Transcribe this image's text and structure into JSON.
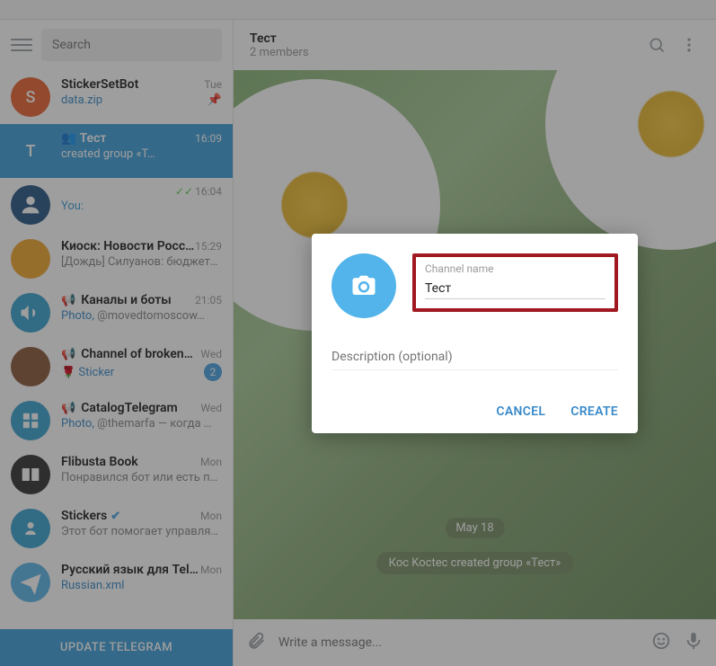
{
  "sidebar": {
    "search_placeholder": "Search",
    "update_label": "UPDATE TELEGRAM",
    "items": [
      {
        "avatar_letter": "S",
        "avatar_class": "orange",
        "title": "StickerSetBot",
        "time": "Tue",
        "preview": "data.zip",
        "preview_class": "blue-text",
        "pinned": true
      },
      {
        "avatar_letter": "Т",
        "avatar_class": "blue",
        "prefix_icon": "👥",
        "title": "Тест",
        "time": "16:09",
        "preview": "created group «Т…",
        "active": true
      },
      {
        "avatar_letter": "",
        "avatar_class": "navy",
        "avatar_img": "bot",
        "title": "",
        "time": "16:04",
        "checks": true,
        "preview_you": "You:",
        "preview": ""
      },
      {
        "avatar_letter": "",
        "avatar_class": "yellow",
        "title": "Киоск: Новости Росс…",
        "time": "15:29",
        "preview": "[Дождь]  Силуанов: бюджет…"
      },
      {
        "avatar_letter": "",
        "avatar_class": "teal",
        "megaphone": true,
        "avatar_mega": true,
        "title": "Каналы и боты",
        "time": "21:05",
        "preview_prefix": "Photo,",
        "preview": " @movedtomoscow…"
      },
      {
        "avatar_letter": "",
        "avatar_class": "brown",
        "megaphone": true,
        "title": "Channel of broken…",
        "time": "Wed",
        "preview_prefix": "🌹 Sticker",
        "preview": "",
        "badge": "2"
      },
      {
        "avatar_letter": "",
        "avatar_class": "teal",
        "megaphone": true,
        "avatar_cat": true,
        "title": "CatalogTelegram",
        "time": "Wed",
        "preview_prefix": "Photo,",
        "preview": " @themarfa — когда …"
      },
      {
        "avatar_letter": "",
        "avatar_class": "dark",
        "avatar_book": true,
        "title": "Flibusta Book",
        "time": "Mon",
        "preview": "Понравился бот или есть п…"
      },
      {
        "avatar_letter": "",
        "avatar_class": "teal",
        "avatar_sticker": true,
        "title": "Stickers",
        "verified": true,
        "time": "Mon",
        "preview": "Этот бот помогает управля…"
      },
      {
        "avatar_letter": "",
        "avatar_class": "sky",
        "avatar_plane": true,
        "title": "Русский язык для Tel…",
        "time": "Mon",
        "preview": "Russian.xml",
        "preview_class": "blue-text"
      }
    ]
  },
  "header": {
    "title": "Тест",
    "subtitle": "2 members"
  },
  "chat": {
    "date": "May 18",
    "system": "Кос Koctec created group «Тест»"
  },
  "composer": {
    "placeholder": "Write a message..."
  },
  "modal": {
    "name_label": "Channel name",
    "name_value": "Тест",
    "desc_placeholder": "Description (optional)",
    "cancel": "CANCEL",
    "create": "CREATE"
  }
}
